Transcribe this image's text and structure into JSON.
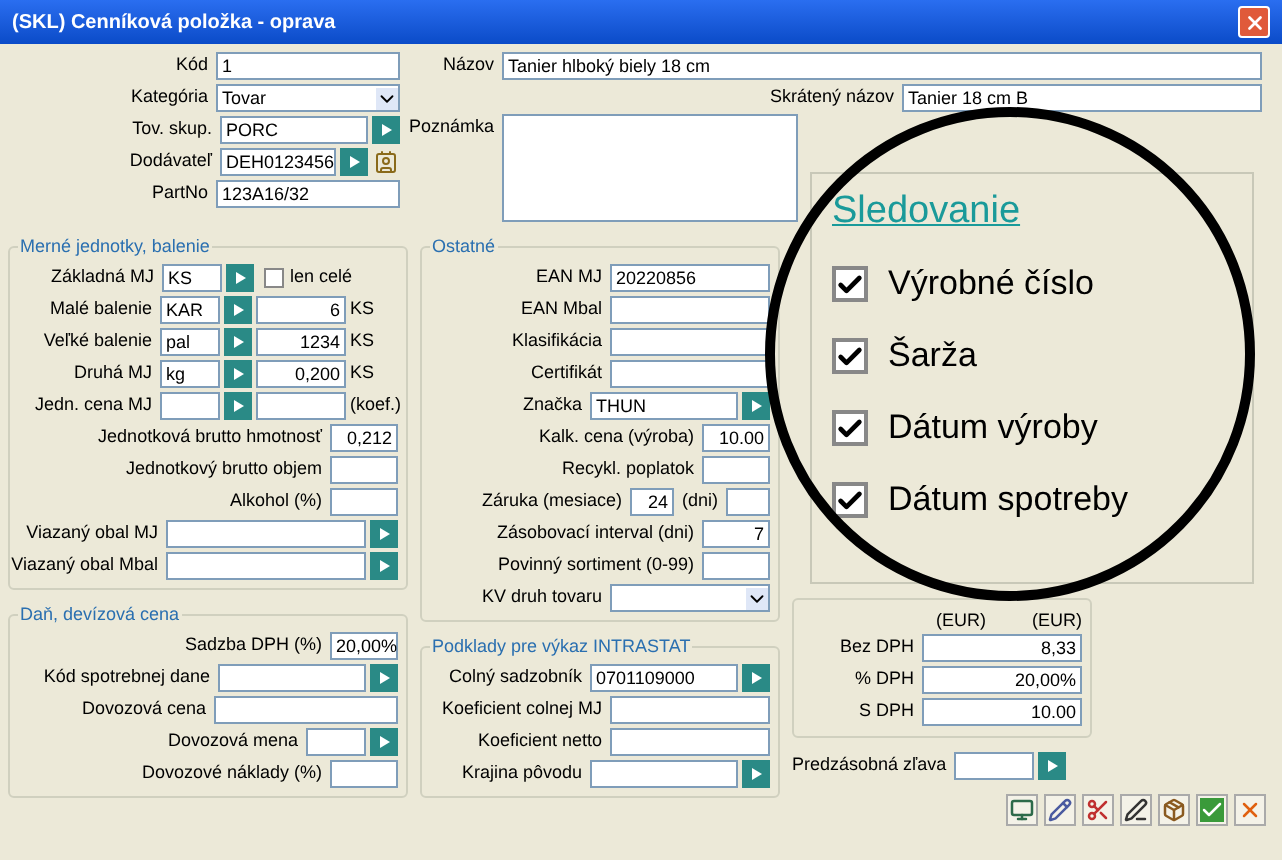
{
  "window": {
    "title": "(SKL) Cenníková položka - oprava"
  },
  "header_fields": [
    {
      "label": "Kód",
      "kind": "text",
      "value": "1"
    },
    {
      "label": "Kategória",
      "kind": "dropdown",
      "value": "Tovar"
    },
    {
      "label": "Tov. skup.",
      "kind": "lookup",
      "value": "PORC"
    },
    {
      "label": "Dodávateľ",
      "kind": "lookup_contact",
      "value": "DEH0123456"
    },
    {
      "label": "PartNo",
      "kind": "text",
      "value": "123A16/32"
    }
  ],
  "name_fields": [
    {
      "label": "Názov",
      "kind": "long",
      "value": "Tanier hlboký biely 18 cm"
    },
    {
      "label": "Skrátený názov",
      "kind": "short",
      "value": "Tanier 18 cm B"
    },
    {
      "label": "Poznámka",
      "kind": "textarea"
    }
  ],
  "units_group": {
    "title": "Merné jednotky, balenie",
    "rows": [
      {
        "label": "Základná MJ",
        "kind": "unit_check",
        "value": "KS",
        "check": {
          "label": "len celé",
          "checked": false
        }
      },
      {
        "label": "Malé balenie",
        "kind": "unit_qty",
        "value": "KAR",
        "qty": "6",
        "unit": "KS"
      },
      {
        "label": "Veľké balenie",
        "kind": "unit_qty",
        "value": "pal",
        "qty": "1234",
        "unit": "KS"
      },
      {
        "label": "Druhá MJ",
        "kind": "unit_qty",
        "value": "kg",
        "qty": "0,200",
        "unit": "KS"
      },
      {
        "label": "Jedn. cena MJ",
        "kind": "unit_qty",
        "unit": "(koef.)"
      },
      {
        "label": "Jednotková brutto hmotnosť",
        "kind": "number",
        "value": "0,212"
      },
      {
        "label": "Jednotkový brutto objem",
        "kind": "number"
      },
      {
        "label": "Alkohol (%)",
        "kind": "number"
      },
      {
        "label": "Viazaný obal MJ",
        "kind": "lookup_wide"
      },
      {
        "label": "Viazaný obal Mbal",
        "kind": "lookup_wide"
      }
    ]
  },
  "tax_group": {
    "title": "Daň, devízová cena",
    "rows": [
      {
        "label": "Sadzba DPH (%)",
        "kind": "number",
        "value": "20,00%"
      },
      {
        "label": "Kód spotrebnej dane",
        "kind": "lookup"
      },
      {
        "label": "Dovozová cena",
        "kind": "text"
      },
      {
        "label": "Dovozová mena",
        "kind": "lookup_short"
      },
      {
        "label": "Dovozové náklady (%)",
        "kind": "number"
      }
    ]
  },
  "other_group": {
    "title": "Ostatné",
    "rows": [
      {
        "label": "EAN MJ",
        "kind": "text",
        "value": "20220856"
      },
      {
        "label": "EAN Mbal",
        "kind": "text"
      },
      {
        "label": "Klasifikácia",
        "kind": "text"
      },
      {
        "label": "Certifikát",
        "kind": "text"
      },
      {
        "label": "Značka",
        "kind": "lookup",
        "value": "THUN"
      },
      {
        "label": "Kalk. cena (výroba)",
        "kind": "number",
        "value": "10.00"
      },
      {
        "label": "Recykl. poplatok",
        "kind": "number"
      },
      {
        "label": "Záruka (mesiace)",
        "kind": "warranty",
        "value": "24",
        "unit": "(dni)"
      },
      {
        "label": "Zásobovací interval (dni)",
        "kind": "number",
        "value": "7"
      },
      {
        "label": "Povinný sortiment (0-99)",
        "kind": "number"
      },
      {
        "label": "KV druh tovaru",
        "kind": "dropdown"
      }
    ]
  },
  "intrastat_group": {
    "title": "Podklady pre výkaz INTRASTAT",
    "rows": [
      {
        "label": "Colný sadzobník",
        "kind": "lookup",
        "value": "0701109000"
      },
      {
        "label": "Koeficient colnej MJ",
        "kind": "text"
      },
      {
        "label": "Koeficient netto",
        "kind": "text"
      },
      {
        "label": "Krajina pôvodu",
        "kind": "lookup"
      }
    ]
  },
  "tracking_group": {
    "title": "Sledovanie",
    "items": [
      {
        "label": "Výrobné číslo",
        "checked": true
      },
      {
        "label": "Šarža",
        "checked": true
      },
      {
        "label": "Dátum výroby",
        "checked": true
      },
      {
        "label": "Dátum spotreby",
        "checked": true
      }
    ]
  },
  "price_group": {
    "columns": [
      "(EUR)",
      "(EUR)"
    ],
    "rows": [
      {
        "label": "Bez DPH",
        "value": "8,33"
      },
      {
        "label": "% DPH",
        "value": "20,00%"
      },
      {
        "label": "S DPH",
        "value": "10.00"
      }
    ]
  },
  "discount": {
    "label": "Predzásobná zľava"
  },
  "toolbar": [
    {
      "kind": "monitor"
    },
    {
      "kind": "pencil"
    },
    {
      "kind": "split"
    },
    {
      "kind": "pen"
    },
    {
      "kind": "box"
    },
    {
      "kind": "ok"
    },
    {
      "kind": "cancel"
    }
  ]
}
